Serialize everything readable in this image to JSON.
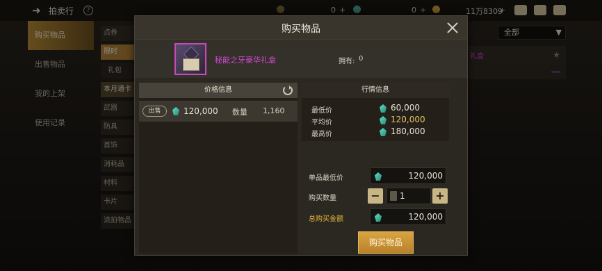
{
  "header": {
    "title": "拍卖行",
    "help": "?",
    "currency1_value": "0",
    "currency2_value": "0",
    "currency3_value": "11万8309"
  },
  "sidebar": {
    "items": [
      {
        "label": "购买物品",
        "active": true
      },
      {
        "label": "出售物品",
        "active": false
      },
      {
        "label": "我的上架",
        "active": false
      },
      {
        "label": "使用记录",
        "active": false
      }
    ]
  },
  "categories": [
    {
      "label": "点券"
    },
    {
      "label": "限时"
    },
    {
      "label": "礼包"
    },
    {
      "label": "本月通卡"
    },
    {
      "label": "武器"
    },
    {
      "label": "防具"
    },
    {
      "label": "首饰"
    },
    {
      "label": "消耗品"
    },
    {
      "label": "材料"
    },
    {
      "label": "卡片"
    },
    {
      "label": "流拍物品"
    }
  ],
  "filter": {
    "selected": "全部"
  },
  "right_card": {
    "name": "礼盒"
  },
  "modal": {
    "title": "购买物品",
    "item_name": "秘能之牙豪华礼盒",
    "owned_label": "拥有:",
    "owned_value": "0",
    "price_info": {
      "header": "价格信息",
      "listing": {
        "tag": "出售",
        "price": "120,000",
        "qty_label": "数量",
        "qty": "1,160"
      }
    },
    "market_info": {
      "header": "行情信息",
      "rows": [
        {
          "label": "最低价",
          "value": "60,000"
        },
        {
          "label": "平均价",
          "value": "120,000"
        },
        {
          "label": "最高价",
          "value": "180,000"
        }
      ]
    },
    "form": {
      "unit_price_label": "单品最低价",
      "unit_price": "120,000",
      "qty_label": "购买数量",
      "qty": "1",
      "total_label": "总购买金额",
      "total": "120,000",
      "minus": "−",
      "plus": "+"
    },
    "buy_button": "购买物品"
  },
  "colors": {
    "accent_gold": "#d9a441",
    "item_rarity": "#d24ad2",
    "gem": "#69e0c8"
  }
}
